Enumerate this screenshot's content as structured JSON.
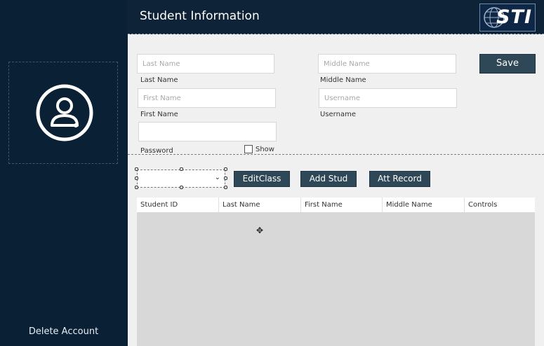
{
  "header": {
    "title": "Student Information",
    "logo_text": "STI"
  },
  "sidebar": {
    "avatar_icon": "user-circle-icon",
    "delete_label": "Delete Account"
  },
  "form": {
    "last_name": {
      "placeholder": "Last Name",
      "label": "Last Name"
    },
    "middle_name": {
      "placeholder": "Middle Name",
      "label": "Middle Name"
    },
    "first_name": {
      "placeholder": "First Name",
      "label": "First Name"
    },
    "username": {
      "placeholder": "Username",
      "label": "Username"
    },
    "password": {
      "placeholder": "",
      "label": "Password"
    },
    "show_label": "Show",
    "save_label": "Save"
  },
  "toolbar": {
    "edit_class": "EditClass",
    "add_stud": "Add Stud",
    "att_record": "Att Record"
  },
  "grid": {
    "columns": [
      "Student ID",
      "Last Name",
      "First Name",
      "Middle Name",
      "Controls"
    ]
  },
  "colors": {
    "sidebar": "#0a2035",
    "header": "#0e2238",
    "button": "#2f4858",
    "panel": "#f0f0f0"
  }
}
